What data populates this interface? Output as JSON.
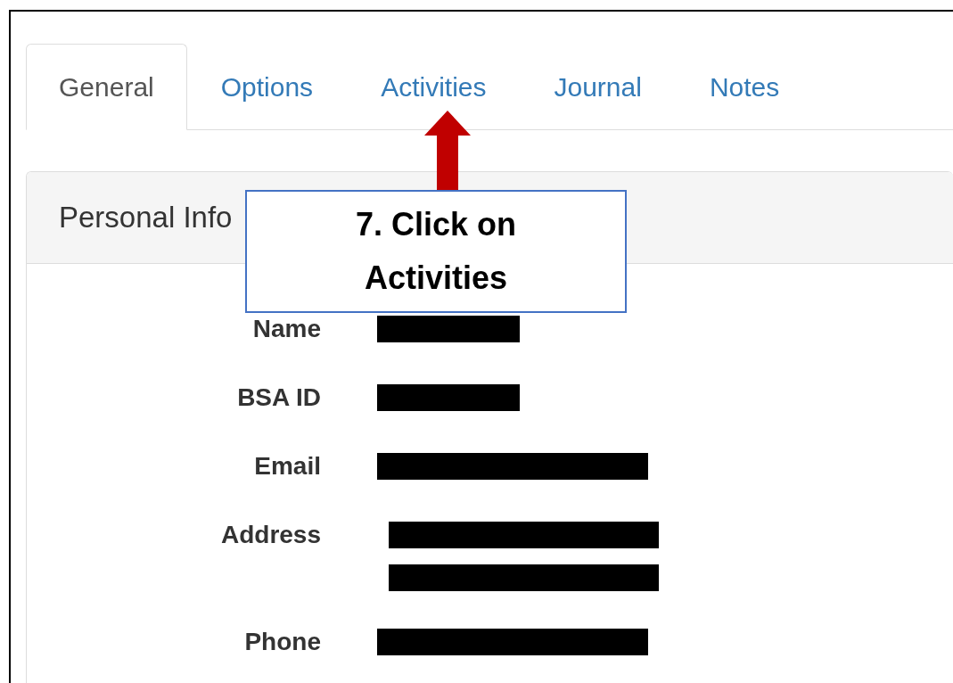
{
  "tabs": [
    {
      "label": "General",
      "selected": true
    },
    {
      "label": "Options",
      "selected": false
    },
    {
      "label": "Activities",
      "selected": false
    },
    {
      "label": "Journal",
      "selected": false
    },
    {
      "label": "Notes",
      "selected": false
    }
  ],
  "panel": {
    "title": "Personal Info"
  },
  "fields": [
    {
      "label": "Name",
      "kind": "single",
      "redacted": true
    },
    {
      "label": "BSA ID",
      "kind": "single",
      "redacted": true
    },
    {
      "label": "Email",
      "kind": "single",
      "redacted": true
    },
    {
      "label": "Address",
      "kind": "double",
      "redacted": true
    },
    {
      "label": "Phone",
      "kind": "single",
      "redacted": true
    }
  ],
  "callout": {
    "text": "7. Click on Activities"
  }
}
